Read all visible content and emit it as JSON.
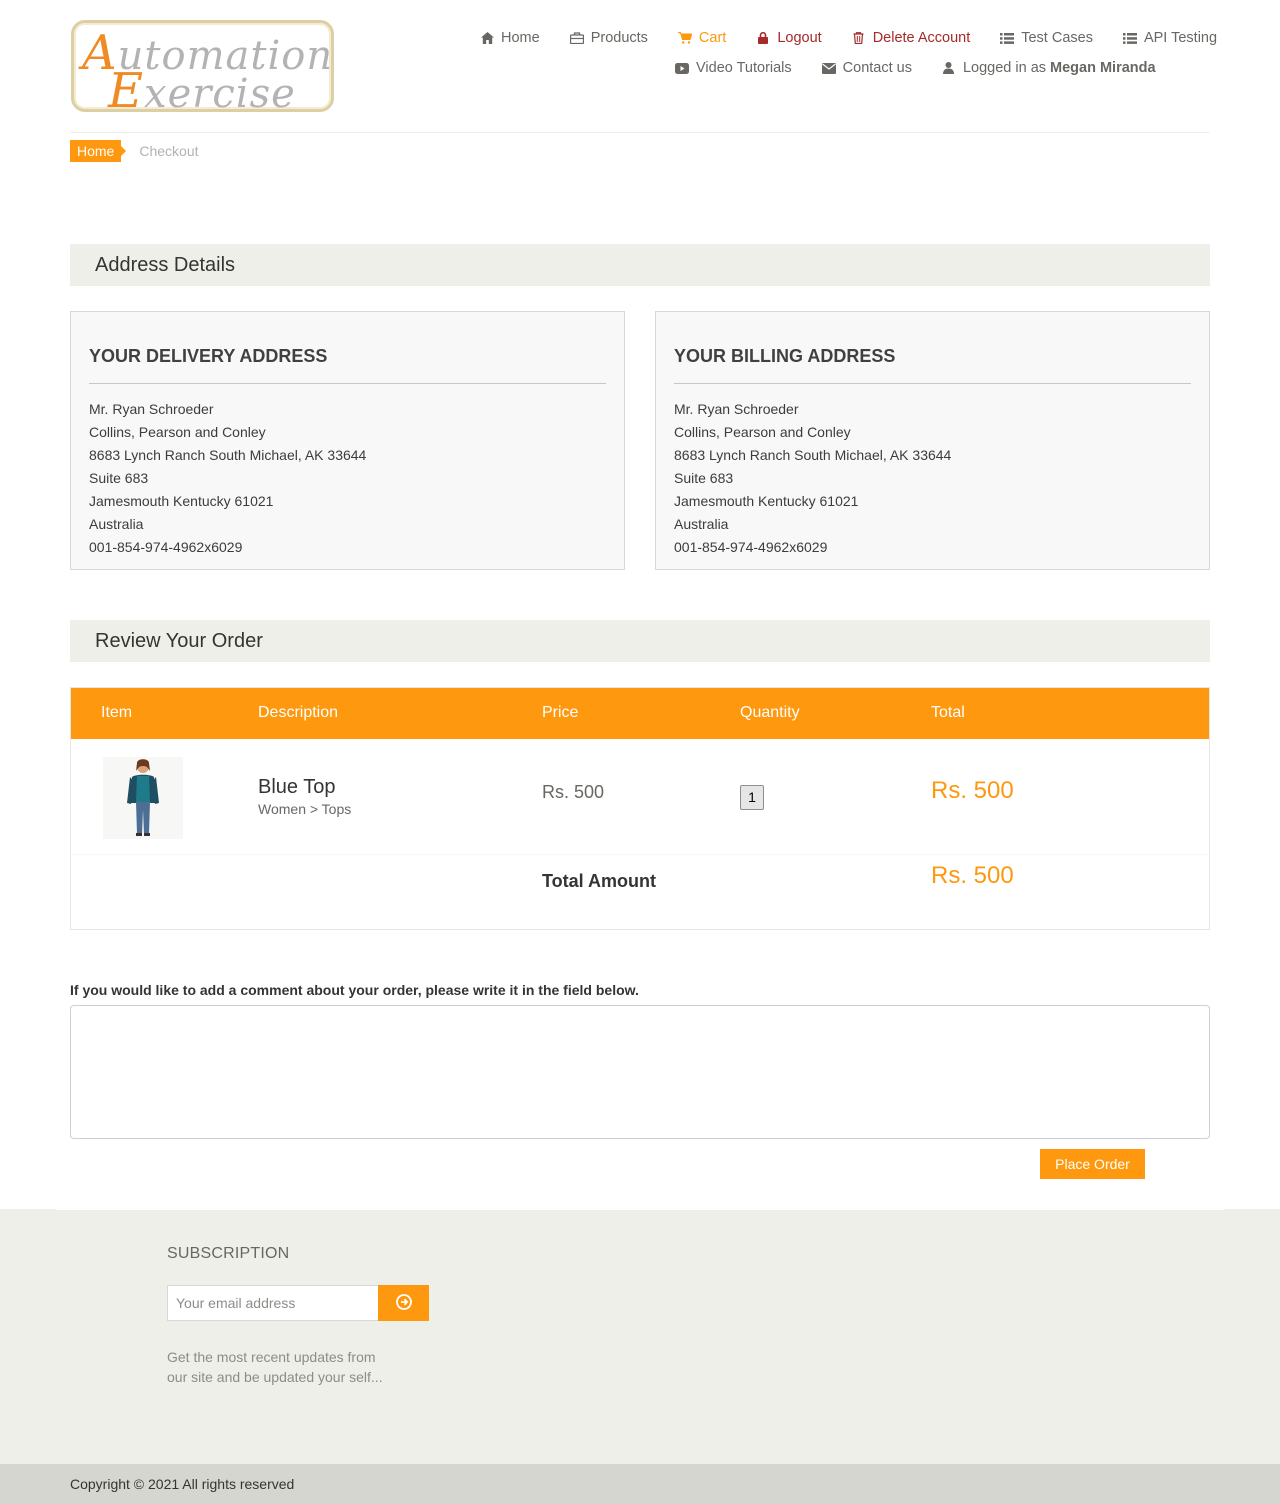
{
  "logo": {
    "line1_cap": "A",
    "line1_rest": "utomation",
    "line2_cap": "E",
    "line2_rest": "xercise"
  },
  "nav": {
    "home": "Home",
    "products": "Products",
    "cart": "Cart",
    "logout": "Logout",
    "delete_account": "Delete Account",
    "test_cases": "Test Cases",
    "api_testing": "API Testing",
    "video_tutorials": "Video Tutorials",
    "contact_us": "Contact us",
    "logged_in_prefix": "Logged in as",
    "logged_in_user": "Megan Miranda"
  },
  "breadcrumb": {
    "home": "Home",
    "current": "Checkout"
  },
  "address_section": {
    "title": "Address Details"
  },
  "delivery": {
    "title": "YOUR DELIVERY ADDRESS",
    "lines": [
      "Mr. Ryan Schroeder",
      "Collins, Pearson and Conley",
      "8683 Lynch Ranch South Michael, AK 33644",
      "Suite 683",
      "Jamesmouth Kentucky 61021",
      "Australia",
      "001-854-974-4962x6029"
    ]
  },
  "billing": {
    "title": "YOUR BILLING ADDRESS",
    "lines": [
      "Mr. Ryan Schroeder",
      "Collins, Pearson and Conley",
      "8683 Lynch Ranch South Michael, AK 33644",
      "Suite 683",
      "Jamesmouth Kentucky 61021",
      "Australia",
      "001-854-974-4962x6029"
    ]
  },
  "review_section": {
    "title": "Review Your Order"
  },
  "order_table": {
    "headers": {
      "item": "Item",
      "description": "Description",
      "price": "Price",
      "quantity": "Quantity",
      "total": "Total"
    },
    "rows": [
      {
        "name": "Blue Top",
        "category": "Women > Tops",
        "price": "Rs. 500",
        "quantity": "1",
        "total": "Rs. 500"
      }
    ],
    "total_label": "Total Amount",
    "total_amount": "Rs. 500"
  },
  "comment": {
    "label": "If you would like to add a comment about your order, please write it in the field below.",
    "value": ""
  },
  "place_order": "Place Order",
  "footer": {
    "subscription_title": "SUBSCRIPTION",
    "email_placeholder": "Your email address",
    "subscription_text": "Get the most recent updates from our site and be updated your self...",
    "copyright": "Copyright © 2021 All rights reserved"
  },
  "colors": {
    "accent": "#FE980F",
    "danger": "#A52A2A",
    "section_bg": "#EFEFE9"
  }
}
